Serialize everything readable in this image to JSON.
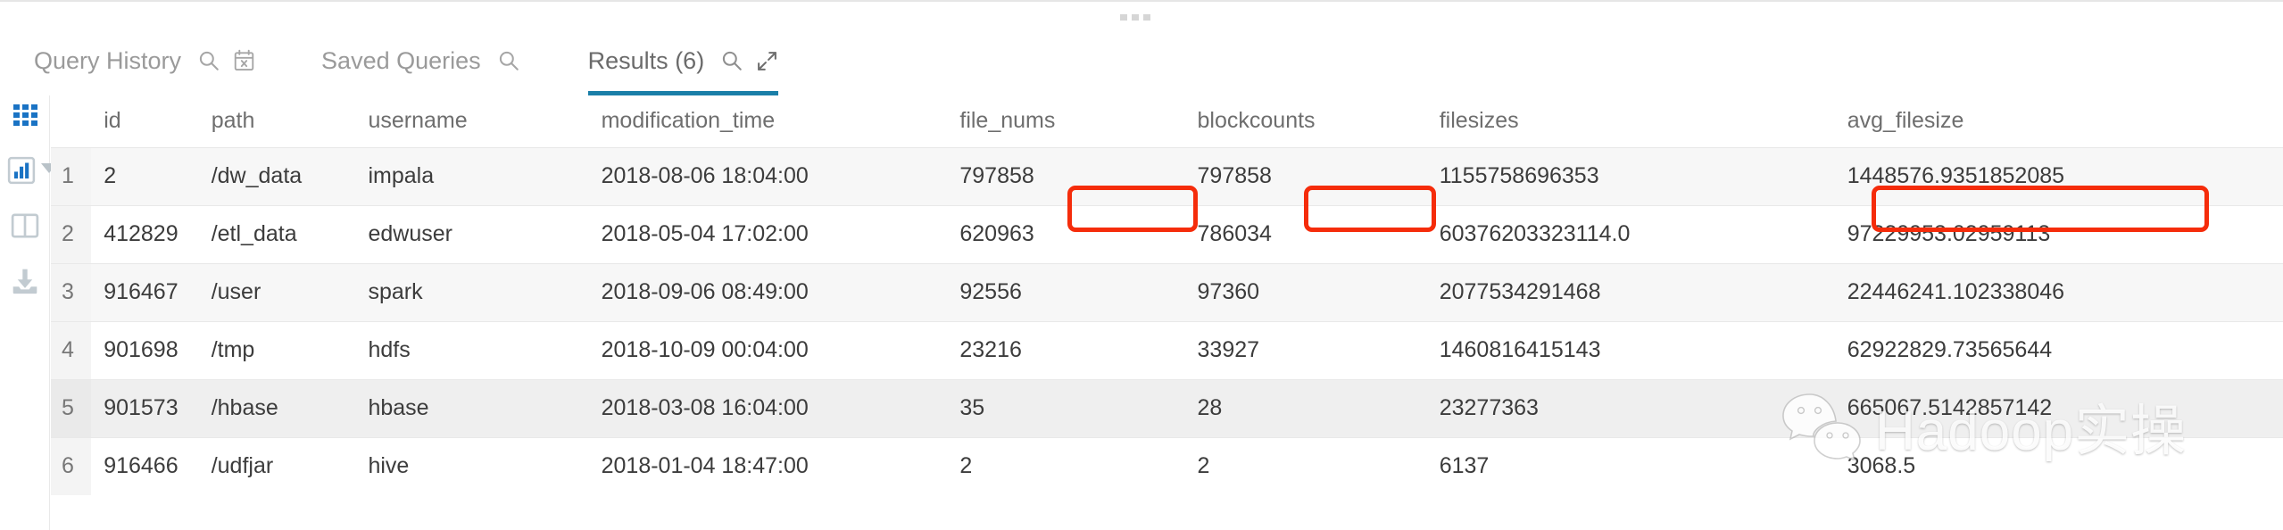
{
  "window": {
    "drag_handle": "resize-handle"
  },
  "tabs": [
    {
      "id": "query-history",
      "label": "Query History",
      "active": false,
      "icons": [
        "search-icon",
        "calendar-clear-icon"
      ]
    },
    {
      "id": "saved-queries",
      "label": "Saved Queries",
      "active": false,
      "icons": [
        "search-icon"
      ]
    },
    {
      "id": "results",
      "label": "Results (6)",
      "active": true,
      "icons": [
        "search-icon",
        "expand-icon"
      ]
    }
  ],
  "rail": {
    "items": [
      {
        "id": "grid-view",
        "icon": "grid-icon",
        "active": true
      },
      {
        "id": "chart-view",
        "icon": "bar-chart-icon",
        "active": false
      },
      {
        "id": "split-view",
        "icon": "split-pane-icon",
        "active": false
      },
      {
        "id": "download",
        "icon": "download-icon",
        "active": false
      }
    ],
    "chart_caret": "chevron-down-icon"
  },
  "table": {
    "columns": [
      "id",
      "path",
      "username",
      "modification_time",
      "file_nums",
      "blockcounts",
      "filesizes",
      "avg_filesize"
    ],
    "rows": [
      {
        "num": "1",
        "id": "2",
        "path": "/dw_data",
        "username": "impala",
        "modification_time": "2018-08-06 18:04:00",
        "file_nums": "797858",
        "blockcounts": "797858",
        "filesizes": "1155758696353",
        "avg_filesize": "1448576.9351852085"
      },
      {
        "num": "2",
        "id": "412829",
        "path": "/etl_data",
        "username": "edwuser",
        "modification_time": "2018-05-04 17:02:00",
        "file_nums": "620963",
        "blockcounts": "786034",
        "filesizes": "60376203323114.0",
        "avg_filesize": "97229953.02959113"
      },
      {
        "num": "3",
        "id": "916467",
        "path": "/user",
        "username": "spark",
        "modification_time": "2018-09-06 08:49:00",
        "file_nums": "92556",
        "blockcounts": "97360",
        "filesizes": "2077534291468",
        "avg_filesize": "22446241.102338046"
      },
      {
        "num": "4",
        "id": "901698",
        "path": "/tmp",
        "username": "hdfs",
        "modification_time": "2018-10-09 00:04:00",
        "file_nums": "23216",
        "blockcounts": "33927",
        "filesizes": "1460816415143",
        "avg_filesize": "62922829.73565644"
      },
      {
        "num": "5",
        "id": "901573",
        "path": "/hbase",
        "username": "hbase",
        "modification_time": "2018-03-08 16:04:00",
        "file_nums": "35",
        "blockcounts": "28",
        "filesizes": "23277363",
        "avg_filesize": "665067.5142857142"
      },
      {
        "num": "6",
        "id": "916466",
        "path": "/udfjar",
        "username": "hive",
        "modification_time": "2018-01-04 18:47:00",
        "file_nums": "2",
        "blockcounts": "2",
        "filesizes": "6137",
        "avg_filesize": "3068.5"
      }
    ]
  },
  "annotations": [
    {
      "id": "file-nums-highlight",
      "target": "row1.file_nums",
      "color": "#f52c0b"
    },
    {
      "id": "blockcounts-highlight",
      "target": "row1.blockcounts",
      "color": "#f52c0b"
    },
    {
      "id": "avg-filesize-highlight",
      "target": "row1.avg_filesize",
      "color": "#f52c0b"
    }
  ],
  "watermark": {
    "text": "Hadoop实操",
    "logo": "wechat-icon"
  },
  "colors": {
    "accent": "#1a7fa8",
    "annotation": "#f52c0b",
    "grid_icon": "#1a73c4",
    "zebra": "#f7f7f7"
  }
}
